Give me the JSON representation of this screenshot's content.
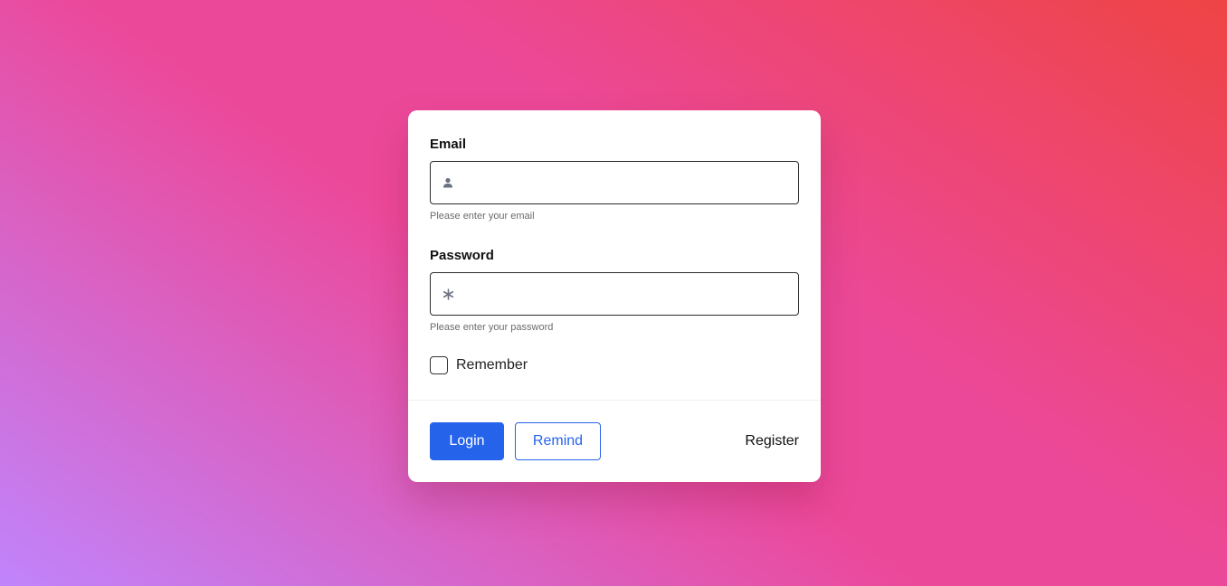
{
  "form": {
    "email": {
      "label": "Email",
      "value": "",
      "placeholder": "",
      "hint": "Please enter your email",
      "icon": "user-icon"
    },
    "password": {
      "label": "Password",
      "value": "",
      "placeholder": "",
      "hint": "Please enter your password",
      "icon": "asterisk-icon"
    },
    "remember": {
      "label": "Remember",
      "checked": false
    }
  },
  "actions": {
    "login_label": "Login",
    "remind_label": "Remind",
    "register_label": "Register"
  },
  "colors": {
    "primary": "#2563eb",
    "background_start": "#c084fc",
    "background_mid": "#ec4899",
    "background_end": "#ef4444"
  }
}
